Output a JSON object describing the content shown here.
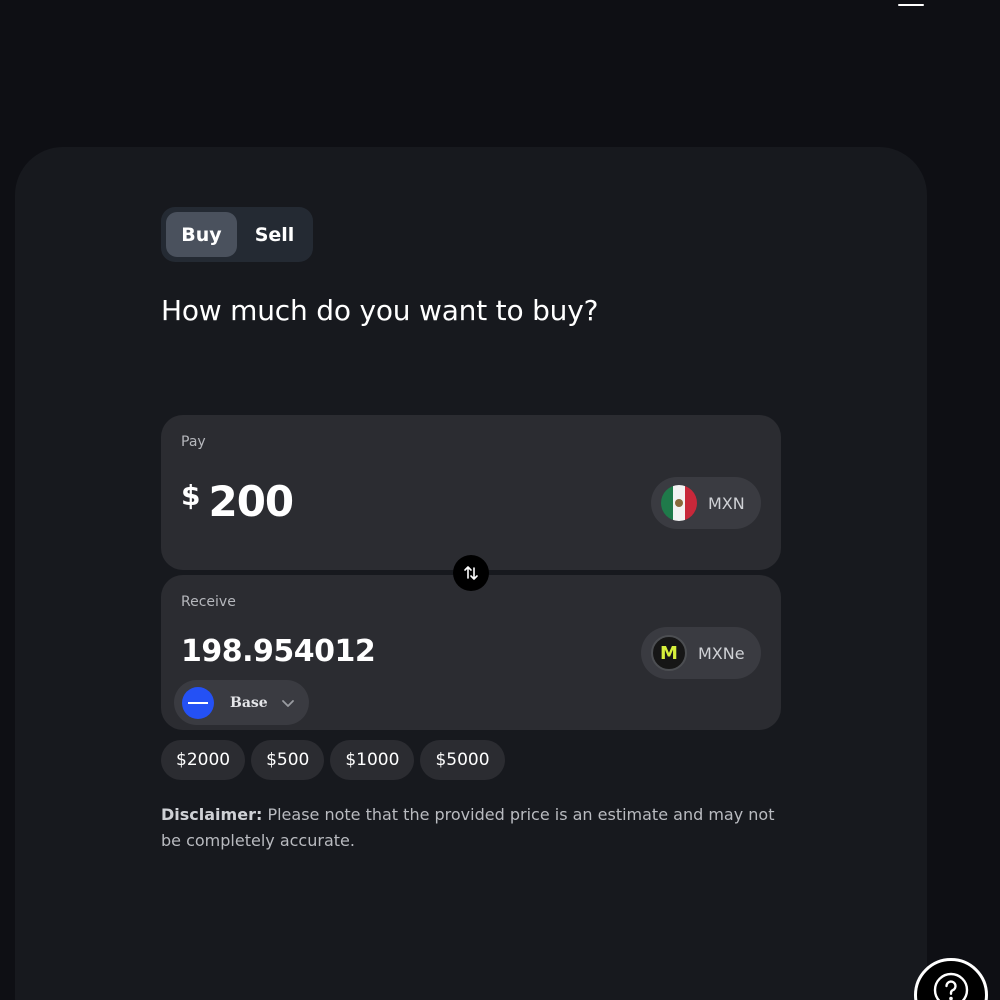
{
  "toggle": {
    "buy_label": "Buy",
    "sell_label": "Sell",
    "active": "Buy"
  },
  "question": "How much do you want to buy?",
  "pay": {
    "label": "Pay",
    "currency_symbol": "$",
    "amount": "200",
    "token": "MXN",
    "token_icon": "mexico-flag-icon"
  },
  "receive": {
    "label": "Receive",
    "amount": "198.954012",
    "token": "MXNe",
    "token_icon": "mxne-icon",
    "token_icon_letter": "M",
    "network": "Base",
    "network_icon": "base-network-icon"
  },
  "swap_icon": "swap-arrows-icon",
  "presets": [
    "$2000",
    "$500",
    "$1000",
    "$5000"
  ],
  "disclaimer": {
    "label": "Disclaimer:",
    "text": " Please note that the provided price is an estimate and may not be completely accurate."
  },
  "help_icon": "question-mark-icon",
  "menu_icon": "hamburger-menu-icon",
  "colors": {
    "background": "#0e0f14",
    "card": "#17191e",
    "panel": "#2b2c31",
    "active_toggle": "#4a515d",
    "base_blue": "#2451f5",
    "mxne_accent": "#d7f03c"
  }
}
